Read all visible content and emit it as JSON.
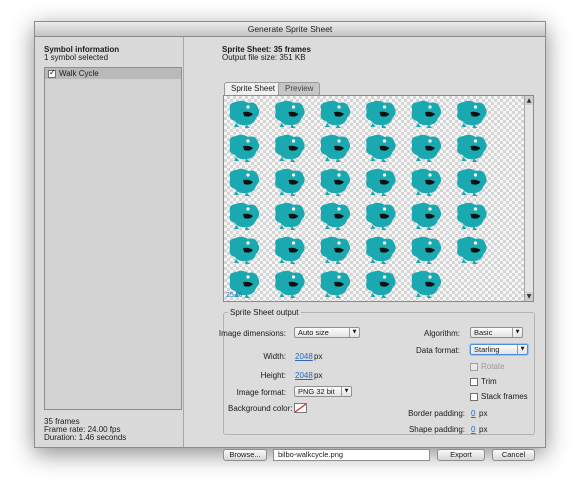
{
  "window": {
    "title": "Generate Sprite Sheet"
  },
  "symbol_info": {
    "heading": "Symbol information",
    "selected_count": "1 symbol selected",
    "symbols": [
      {
        "label": "Walk Cycle",
        "checked": true
      }
    ],
    "frames": "35 frames",
    "frame_rate": "Frame rate: 24.00 fps",
    "duration": "Duration: 1.46 seconds"
  },
  "sprite_sheet": {
    "heading": "Sprite Sheet: 35 frames",
    "file_size": "Output file size: 351 KB",
    "tabs": [
      "Sprite Sheet",
      "Preview"
    ],
    "zoom": "25 %",
    "frame_count": 35,
    "columns": 6,
    "sprite_color": "#1aa9b1"
  },
  "output": {
    "legend": "Sprite Sheet output",
    "image_dimensions_label": "Image dimensions:",
    "image_dimensions_value": "Auto size",
    "width_label": "Width:",
    "width_value": "2048",
    "height_label": "Height:",
    "height_value": "2048",
    "unit_px": "px",
    "image_format_label": "Image format:",
    "image_format_value": "PNG 32 bit",
    "background_color_label": "Background color:",
    "algorithm_label": "Algorithm:",
    "algorithm_value": "Basic",
    "data_format_label": "Data format:",
    "data_format_value": "Starling",
    "rotate_label": "Rotate",
    "trim_label": "Trim",
    "stack_frames_label": "Stack frames",
    "border_padding_label": "Border padding:",
    "border_padding_value": "0",
    "shape_padding_label": "Shape padding:",
    "shape_padding_value": "0"
  },
  "footer": {
    "browse_label": "Browse...",
    "path_value": "bilbo-walkcycle.png",
    "export_label": "Export",
    "cancel_label": "Cancel"
  }
}
